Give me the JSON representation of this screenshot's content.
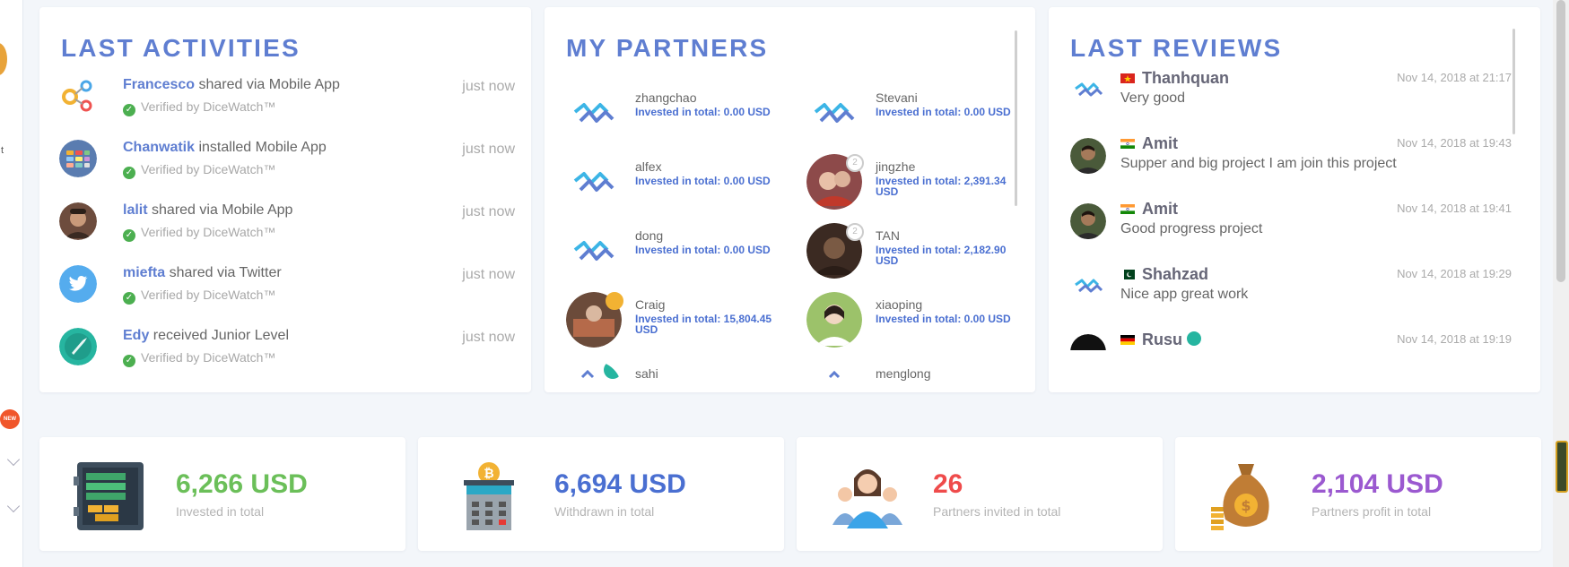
{
  "left_sidebar": {
    "fragment": "t",
    "new_badge": "NEW"
  },
  "activities": {
    "title": "LAST ACTIVITIES",
    "items": [
      {
        "user": "Francesco",
        "action": "shared via Mobile App",
        "verified": "Verified by DiceWatch™",
        "time": "just now",
        "icon": "mobile-app-share-icon"
      },
      {
        "user": "Chanwatik",
        "action": "installed Mobile App",
        "verified": "Verified by DiceWatch™",
        "time": "just now",
        "icon": "app-install-icon"
      },
      {
        "user": "lalit",
        "action": "shared via Mobile App",
        "verified": "Verified by DiceWatch™",
        "time": "just now",
        "icon": "user-avatar"
      },
      {
        "user": "miefta",
        "action": "shared via Twitter",
        "verified": "Verified by DiceWatch™",
        "time": "just now",
        "icon": "twitter-bird-icon"
      },
      {
        "user": "Edy",
        "action": "received Junior Level",
        "verified": "Verified by DiceWatch™",
        "time": "just now",
        "icon": "rocket-level-icon"
      }
    ]
  },
  "partners": {
    "title": "MY PARTNERS",
    "items": [
      {
        "name": "zhangchao",
        "invested": "Invested in total: 0.00 USD",
        "avatar": "logo",
        "rank": ""
      },
      {
        "name": "Stevani",
        "invested": "Invested in total: 0.00 USD",
        "avatar": "logo",
        "rank": ""
      },
      {
        "name": "alfex",
        "invested": "Invested in total: 0.00 USD",
        "avatar": "logo",
        "rank": ""
      },
      {
        "name": "jingzhe",
        "invested": "Invested in total: 2,391.34 USD",
        "avatar": "photo",
        "rank": "2"
      },
      {
        "name": "dong",
        "invested": "Invested in total: 0.00 USD",
        "avatar": "logo",
        "rank": ""
      },
      {
        "name": "TAN",
        "invested": "Invested in total: 2,182.90 USD",
        "avatar": "photo",
        "rank": "2"
      },
      {
        "name": "Craig",
        "invested": "Invested in total: 15,804.45 USD",
        "avatar": "photo",
        "rank": "gold"
      },
      {
        "name": "xiaoping",
        "invested": "Invested in total: 0.00 USD",
        "avatar": "photo",
        "rank": ""
      },
      {
        "name": "sahi",
        "invested": "",
        "avatar": "logo",
        "rank": ""
      },
      {
        "name": "menglong",
        "invested": "",
        "avatar": "logo",
        "rank": ""
      }
    ]
  },
  "reviews": {
    "title": "LAST REVIEWS",
    "items": [
      {
        "name": "Thanhquan",
        "date": "Nov 14, 2018 at 21:17",
        "text": "Very good",
        "flag": "vietnam",
        "avatar": "logo"
      },
      {
        "name": "Amit",
        "date": "Nov 14, 2018 at 19:43",
        "text": "Supper and big project I am join this project",
        "flag": "india",
        "avatar": "photo"
      },
      {
        "name": "Amit",
        "date": "Nov 14, 2018 at 19:41",
        "text": "Good progress project",
        "flag": "india",
        "avatar": "photo"
      },
      {
        "name": "Shahzad",
        "date": "Nov 14, 2018 at 19:29",
        "text": "Nice app great work",
        "flag": "pakistan",
        "avatar": "logo"
      },
      {
        "name": "Rusu",
        "date": "Nov 14, 2018 at 19:19",
        "text": "",
        "flag": "germany",
        "avatar": "photo"
      }
    ]
  },
  "stats": [
    {
      "value": "6,266 USD",
      "label": "Invested in total",
      "color": "#6bbf59",
      "icon": "safe-gold-icon"
    },
    {
      "value": "6,694 USD",
      "label": "Withdrawn in total",
      "color": "#4a6fd1",
      "icon": "atm-bitcoin-icon"
    },
    {
      "value": "26",
      "label": "Partners invited in total",
      "color": "#ef4b4b",
      "icon": "people-group-icon"
    },
    {
      "value": "2,104 USD",
      "label": "Partners profit in total",
      "color": "#9b59d0",
      "icon": "money-bag-icon"
    }
  ]
}
